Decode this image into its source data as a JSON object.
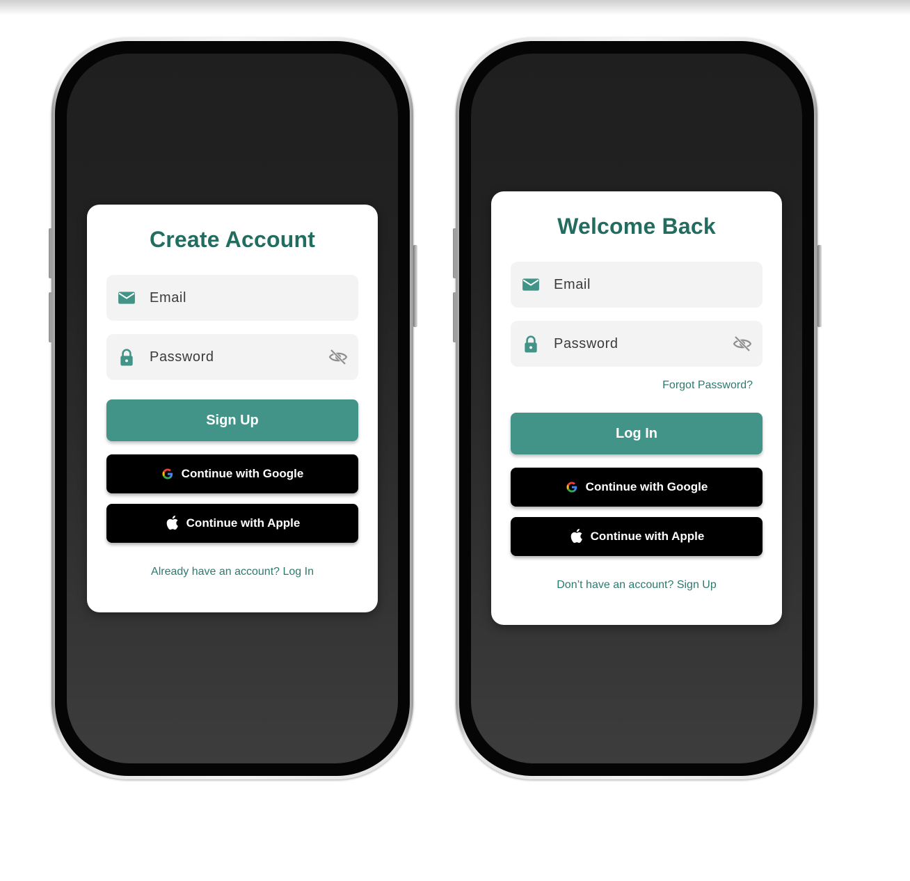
{
  "colors": {
    "accent": "#419487",
    "title": "#236d60",
    "link": "#2c7a6e",
    "field_bg": "#f3f3f3",
    "social_bg": "#000000"
  },
  "signup": {
    "title": "Create Account",
    "email": {
      "label": "Email",
      "icon": "mail-icon"
    },
    "password": {
      "label": "Password",
      "icon": "lock-icon",
      "toggle_icon": "eye-off-icon"
    },
    "primary_button": "Sign Up",
    "google_button": "Continue with Google",
    "apple_button": "Continue with Apple",
    "footer_link": "Already have an account? Log In"
  },
  "login": {
    "title": "Welcome Back",
    "email": {
      "label": "Email",
      "icon": "mail-icon"
    },
    "password": {
      "label": "Password",
      "icon": "lock-icon",
      "toggle_icon": "eye-off-icon"
    },
    "forgot_link": "Forgot Password?",
    "primary_button": "Log In",
    "google_button": "Continue with Google",
    "apple_button": "Continue with Apple",
    "footer_link": "Don’t have an account? Sign Up"
  }
}
